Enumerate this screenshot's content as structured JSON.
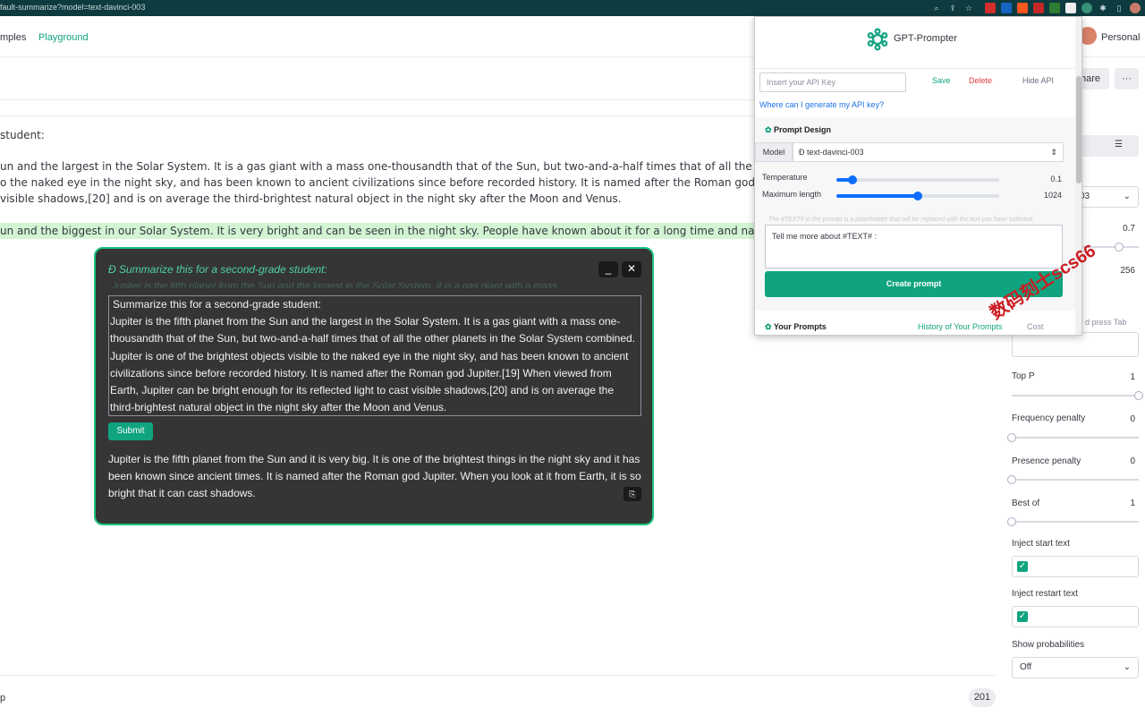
{
  "browser": {
    "url": "fault-summarize?model=text-davinci-003"
  },
  "nav": {
    "examples": "mples",
    "playground": "Playground",
    "account": "Personal"
  },
  "header": {
    "share_label": "hare",
    "more_label": "···"
  },
  "editor": {
    "line1": "student:",
    "line2": "un and the largest in the Solar System. It is a gas giant with a mass one-thousandth that of the Sun, but two-and-a-half times that of all the other planets in",
    "line3": "o the naked eye in the night sky, and has been known to ancient civilizations since before recorded history. It is named after the Roman god Jupiter.[19] Whe",
    "line4": "visible shadows,[20] and is on average the third-brightest natural object in the night sky after the Moon and Venus.",
    "completion": "un and the biggest in our Solar System. It is very bright and can be seen in the night sky. People have known about it for a long time and named it after the R",
    "bottom_left": "p",
    "token_count": "201"
  },
  "settings": {
    "model_value": "03",
    "temperature_value": "0.7",
    "max_length_value": "256",
    "stop_hint": "d press Tab",
    "top_p_label": "Top P",
    "top_p_value": "1",
    "frequency_label": "Frequency penalty",
    "frequency_value": "0",
    "presence_label": "Presence penalty",
    "presence_value": "0",
    "best_of_label": "Best of",
    "best_of_value": "1",
    "inject_start_label": "Inject start text",
    "inject_restart_label": "Inject restart text",
    "show_prob_label": "Show probabilities",
    "show_prob_value": "Off",
    "levels": {
      "temperature": 0.7,
      "top_p": 1,
      "frequency": 0,
      "presence": 0,
      "best_of": 0
    }
  },
  "popup": {
    "title": "Summarize this for a second-grade student:",
    "ghost": "Jupiter is the fifth planet from the Sun and the largest in the Solar System. It is a gas giant with a mass",
    "minimize": "_",
    "close": "✕",
    "prompt_line0": "Summarize this for a second-grade student:",
    "prompt_body": "Jupiter is the fifth planet from the Sun and the largest in the Solar System. It is a gas giant with a mass one-thousandth that of the Sun, but two-and-a-half times that of all the other planets in the Solar System combined. Jupiter is one of the brightest objects visible to the naked eye in the night sky, and has been known to ancient civilizations since before recorded history. It is named after the Roman god Jupiter.[19] When viewed from Earth, Jupiter can be bright enough for its reflected light to cast visible shadows,[20] and is on average the third-brightest natural object in the night sky after the Moon and Venus.",
    "submit": "Submit",
    "result": "Jupiter is the fifth planet from the Sun and it is very big. It is one of the brightest things in the night sky and it has been known since ancient times. It is named after the Roman god Jupiter. When you look at it from Earth, it is so bright that it can cast shadows."
  },
  "extension": {
    "name": "GPT-Prompter",
    "api_placeholder": "Insert your API Key",
    "save": "Save",
    "delete": "Delete",
    "hide_api": "Hide API",
    "api_help": "Where can I generate my API key?",
    "prompt_design": "Prompt Design",
    "model_label": "Model",
    "model_value": "text-davinci-003",
    "temperature_label": "Temperature",
    "temperature_value": "0.1",
    "max_length_label": "Maximum length",
    "max_length_value": "1024",
    "hint": "The #TEXT# in the prompt is a placeholder that will be replaced with the text you have selected.",
    "prompt_text": "Tell me more about #TEXT# :",
    "create": "Create prompt",
    "your_prompts": "Your Prompts",
    "history": "History of Your Prompts",
    "cost": "Cost",
    "levels": {
      "temperature": 0.1,
      "max_length": 0.5
    }
  },
  "watermark": "数码刻士scs66",
  "colors": {
    "accent": "#10a37f",
    "popup_bg": "#353535",
    "highlight": "#d2f4d3",
    "slider": "#0d6efd",
    "danger": "#e03a3a"
  }
}
